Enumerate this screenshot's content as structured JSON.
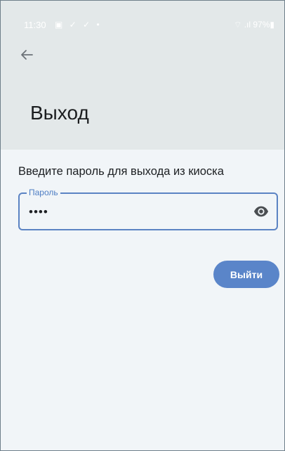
{
  "status_bar": {
    "time": "11:30",
    "notification_icons": "▣ ✓ ✓ •",
    "battery": "⌔ .ıl 97%▮"
  },
  "header": {
    "title": "Выход"
  },
  "main": {
    "prompt": "Введите пароль для выхода из киоска",
    "password_field": {
      "label": "Пароль",
      "value": "••••"
    },
    "exit_button_label": "Выйти"
  },
  "colors": {
    "header_bg": "#e3e8e9",
    "content_bg": "#f1f5f8",
    "accent": "#5a85c9"
  },
  "icons": [
    "back-arrow-icon",
    "eye-icon"
  ]
}
